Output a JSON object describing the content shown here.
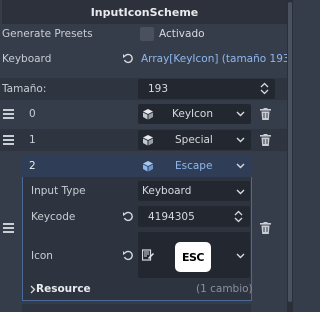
{
  "title": "InputIconScheme",
  "generate_presets": {
    "label": "Generate Presets",
    "checkbox_label": "Activado",
    "checked": false
  },
  "keyboard": {
    "label": "Keyboard",
    "value": "Array[KeyIcon] (tamaño 193"
  },
  "size": {
    "label": "Tamaño:",
    "value": "193"
  },
  "items": [
    {
      "index": "0",
      "type": "KeyIcon"
    },
    {
      "index": "1",
      "type": "Special"
    },
    {
      "index": "2",
      "type": "Escape"
    }
  ],
  "expanded": {
    "input_type": {
      "label": "Input Type",
      "value": "Keyboard"
    },
    "keycode": {
      "label": "Keycode",
      "value": "4194305"
    },
    "icon": {
      "label": "Icon",
      "preview_text": "ESC"
    },
    "resource": {
      "label": "Resource",
      "changes": "(1 cambio)"
    }
  },
  "colors": {
    "accent": "#8fb7ee",
    "background": "#363d4a",
    "field": "#232830",
    "highlight": "#2f3e56"
  }
}
